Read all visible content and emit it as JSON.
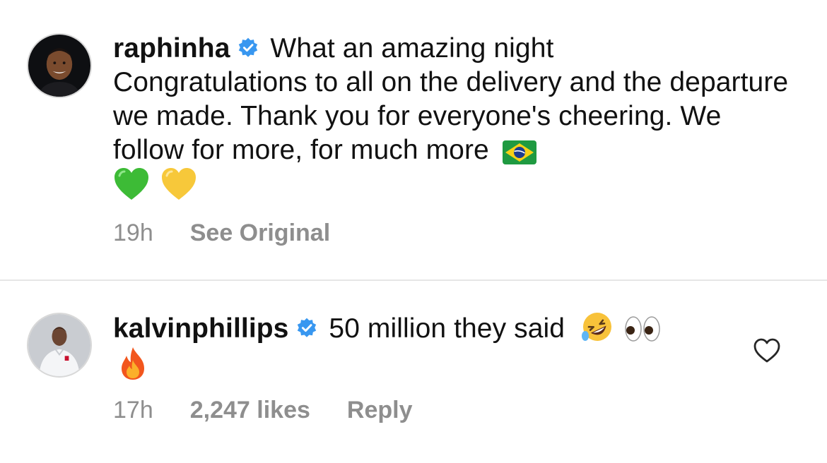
{
  "comments": [
    {
      "username": "raphinha",
      "verified": true,
      "text_line1": "What an amazing night",
      "text_body": "Congratulations to all on the delivery and the departure we made. Thank you for everyone's cheering. We follow for more, for much more",
      "emojis": [
        "brazil-flag",
        "green-heart",
        "yellow-heart"
      ],
      "time": "19h",
      "action_label": "See Original"
    },
    {
      "username": "kalvinphillips",
      "verified": true,
      "text": "50 million they said",
      "emojis": [
        "rolling-on-floor-laughing",
        "eyes",
        "fire"
      ],
      "time": "17h",
      "likes": "2,247 likes",
      "action_label": "Reply"
    }
  ],
  "colors": {
    "verified_blue": "#3897f0",
    "meta_gray": "#8e8e8e",
    "divider": "#e6e6e6"
  }
}
